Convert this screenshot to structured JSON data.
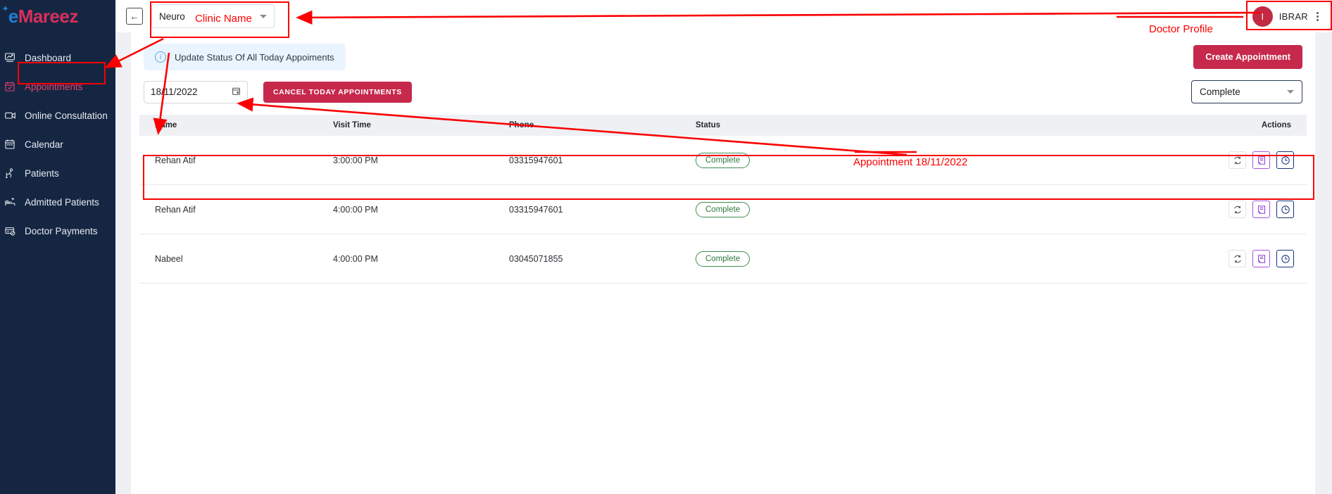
{
  "app": {
    "logo_prefix": "e",
    "logo_main": "Mareez",
    "accent_pink": "#d6305c",
    "accent_blue": "#1f7fd0",
    "sidebar_bg": "#152642",
    "annotation_color": "#fb0000"
  },
  "sidebar": {
    "items": [
      {
        "label": "Dashboard",
        "icon": "chart-icon",
        "active": false
      },
      {
        "label": "Appointments",
        "icon": "calendar-check-icon",
        "active": true
      },
      {
        "label": "Online Consultation",
        "icon": "video-camera-icon",
        "active": false
      },
      {
        "label": "Calendar",
        "icon": "calendar-icon",
        "active": false
      },
      {
        "label": "Patients",
        "icon": "patient-icon",
        "active": false
      },
      {
        "label": "Admitted Patients",
        "icon": "bed-plus-icon",
        "active": false
      },
      {
        "label": "Doctor Payments",
        "icon": "payment-card-icon",
        "active": false
      }
    ]
  },
  "topbar": {
    "back_icon": "back-arrow-icon",
    "clinic_select": {
      "value": "Neuro",
      "caret_icon": "chevron-down-icon"
    },
    "profile": {
      "initial": "I",
      "name": "IBRAR",
      "menu_icon": "kebab-menu-icon"
    }
  },
  "main": {
    "alert": {
      "icon": "info-icon",
      "text": "Update Status Of All Today Appoiments"
    },
    "create_button": "Create Appointment",
    "date_filter": {
      "value": "18/11/2022",
      "icon": "calendar-icon"
    },
    "cancel_button": "CANCEL TODAY APPOINTMENTS",
    "status_filter": {
      "value": "Complete",
      "caret_icon": "chevron-down-icon"
    },
    "table": {
      "columns": [
        "Name",
        "Visit Time",
        "Phone",
        "Status",
        "Actions"
      ],
      "rows": [
        {
          "name": "Rehan Atif",
          "visit_time": "3:00:00 PM",
          "phone": "03315947601",
          "status": "Complete"
        },
        {
          "name": "Rehan Atif",
          "visit_time": "4:00:00 PM",
          "phone": "03315947601",
          "status": "Complete"
        },
        {
          "name": "Nabeel",
          "visit_time": "4:00:00 PM",
          "phone": "03045071855",
          "status": "Complete"
        }
      ],
      "row_actions": [
        {
          "icon": "refresh-icon",
          "name": "refresh-status-button"
        },
        {
          "icon": "note-icon",
          "name": "prescription-note-button"
        },
        {
          "icon": "clock-icon",
          "name": "reschedule-time-button"
        }
      ]
    }
  },
  "annotations": [
    {
      "id": "clinic-name",
      "text": "Clinic Name"
    },
    {
      "id": "doctor-profile",
      "text": "Doctor Profile"
    },
    {
      "id": "appointment-date",
      "text": "Appointment 18/11/2022"
    }
  ]
}
